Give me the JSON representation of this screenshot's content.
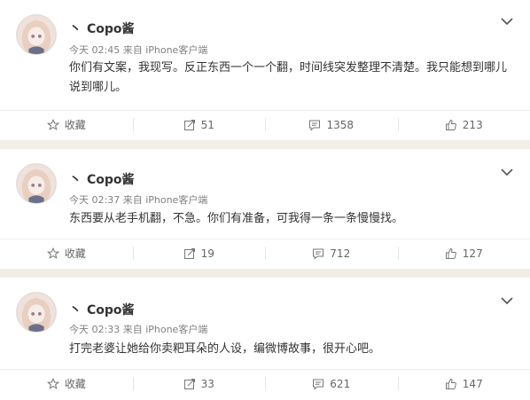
{
  "posts": [
    {
      "username": "Copo酱",
      "prefix": "丶",
      "meta": "今天 02:45 来自 iPhone客户端",
      "content": "你们有文案，我现写。反正东西一个一个翻，时间线突发整理不清楚。我只能想到哪儿说到哪儿。",
      "actions": {
        "favorite_label": "收藏",
        "repost_count": "51",
        "comment_count": "1358",
        "like_count": "213"
      }
    },
    {
      "username": "Copo酱",
      "prefix": "丶",
      "meta": "今天 02:37 来自 iPhone客户端",
      "content": "东西要从老手机翻，不急。你们有准备，可我得一条一条慢慢找。",
      "actions": {
        "favorite_label": "收藏",
        "repost_count": "19",
        "comment_count": "712",
        "like_count": "127"
      }
    },
    {
      "username": "Copo酱",
      "prefix": "丶",
      "meta": "今天 02:33 来自 iPhone客户端",
      "content": "打完老婆让她给你卖粑耳朵的人设，编微博故事，很开心吧。",
      "actions": {
        "favorite_label": "收藏",
        "repost_count": "33",
        "comment_count": "621",
        "like_count": "147"
      }
    }
  ],
  "icons": {
    "favorite": "star-icon",
    "repost": "repost-icon",
    "comment": "comment-icon",
    "like": "thumbs-up-icon",
    "menu": "chevron-down-icon"
  }
}
